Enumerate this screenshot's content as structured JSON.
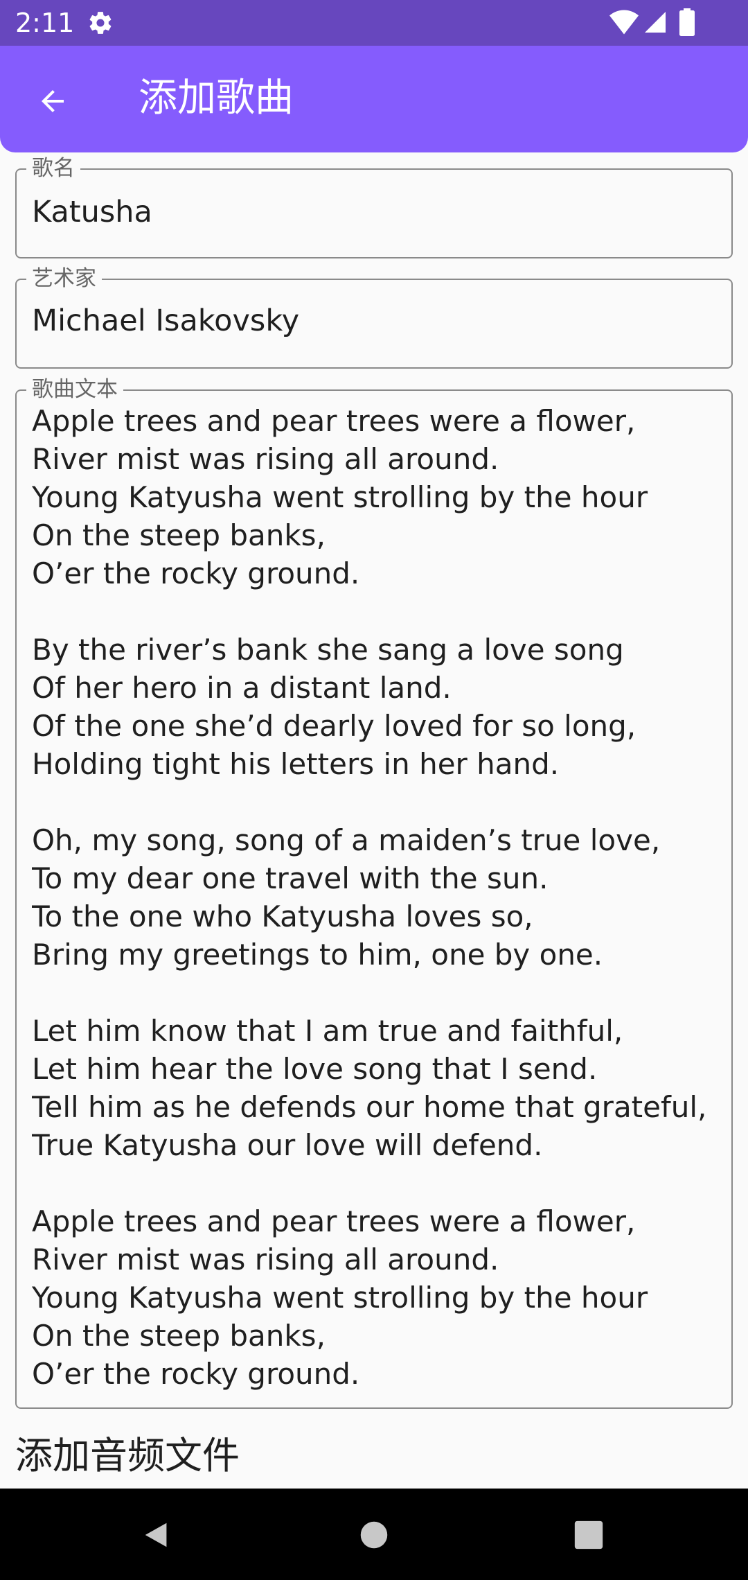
{
  "status_bar": {
    "time": "2:11",
    "icons": [
      "settings-gear-icon",
      "wifi-icon",
      "cell-signal-icon",
      "battery-icon"
    ]
  },
  "app_bar": {
    "title": "添加歌曲",
    "back_icon": "arrow-back-icon",
    "color": "#855cfd"
  },
  "form": {
    "title_field": {
      "label": "歌名",
      "value": "Katusha"
    },
    "artist_field": {
      "label": "艺术家",
      "value": "Michael Isakovsky"
    },
    "lyrics_field": {
      "label": "歌曲文本",
      "value": "Apple trees and pear trees were a flower,\nRiver mist was rising all around.\nYoung Katyusha went strolling by the hour\nOn the steep banks,\nO’er the rocky ground.\n\nBy the river’s bank she sang a love song\nOf her hero in a distant land.\nOf the one she’d dearly loved for so long,\nHolding tight his letters in her hand.\n\nOh, my song, song of a maiden’s true love,\nTo my dear one travel with the sun.\nTo the one who Katyusha loves so,\nBring my greetings to him, one by one.\n\nLet him know that I am true and faithful,\nLet him hear the love song that I send.\nTell him as he defends our home that grateful,\nTrue Katyusha our love will defend.\n\nApple trees and pear trees were a flower,\nRiver mist was rising all around.\nYoung Katyusha went strolling by the hour\nOn the steep banks,\nO’er the rocky ground."
    },
    "audio_section_heading": "添加音频文件"
  },
  "nav_bar": {
    "icons": [
      "nav-back-icon",
      "nav-home-icon",
      "nav-recents-icon"
    ]
  }
}
